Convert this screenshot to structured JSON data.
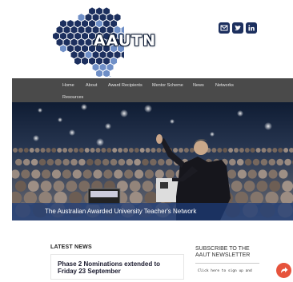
{
  "header": {
    "logo_text": "AAUTN",
    "social": [
      {
        "name": "email-icon"
      },
      {
        "name": "twitter-icon"
      },
      {
        "name": "linkedin-icon"
      }
    ]
  },
  "nav": {
    "items": [
      "Home",
      "About",
      "Award Recipients",
      "Mentor Scheme",
      "News",
      "Networks",
      "Resources"
    ]
  },
  "hero": {
    "caption": "The Australian Awarded University Teacher's Network"
  },
  "news": {
    "heading": "LATEST NEWS",
    "items": [
      {
        "title": "Phase 2 Nominations extended to Friday 23 September"
      }
    ]
  },
  "newsletter": {
    "heading": "SUBSCRIBE TO THE AAUT NEWSLETTER",
    "link": "Click here to sign up and"
  },
  "colors": {
    "brand_navy": "#1c2f5e",
    "nav_bg": "#4a4a4a",
    "share_button": "#e6533c",
    "hex_light": "#6f8fc7"
  }
}
